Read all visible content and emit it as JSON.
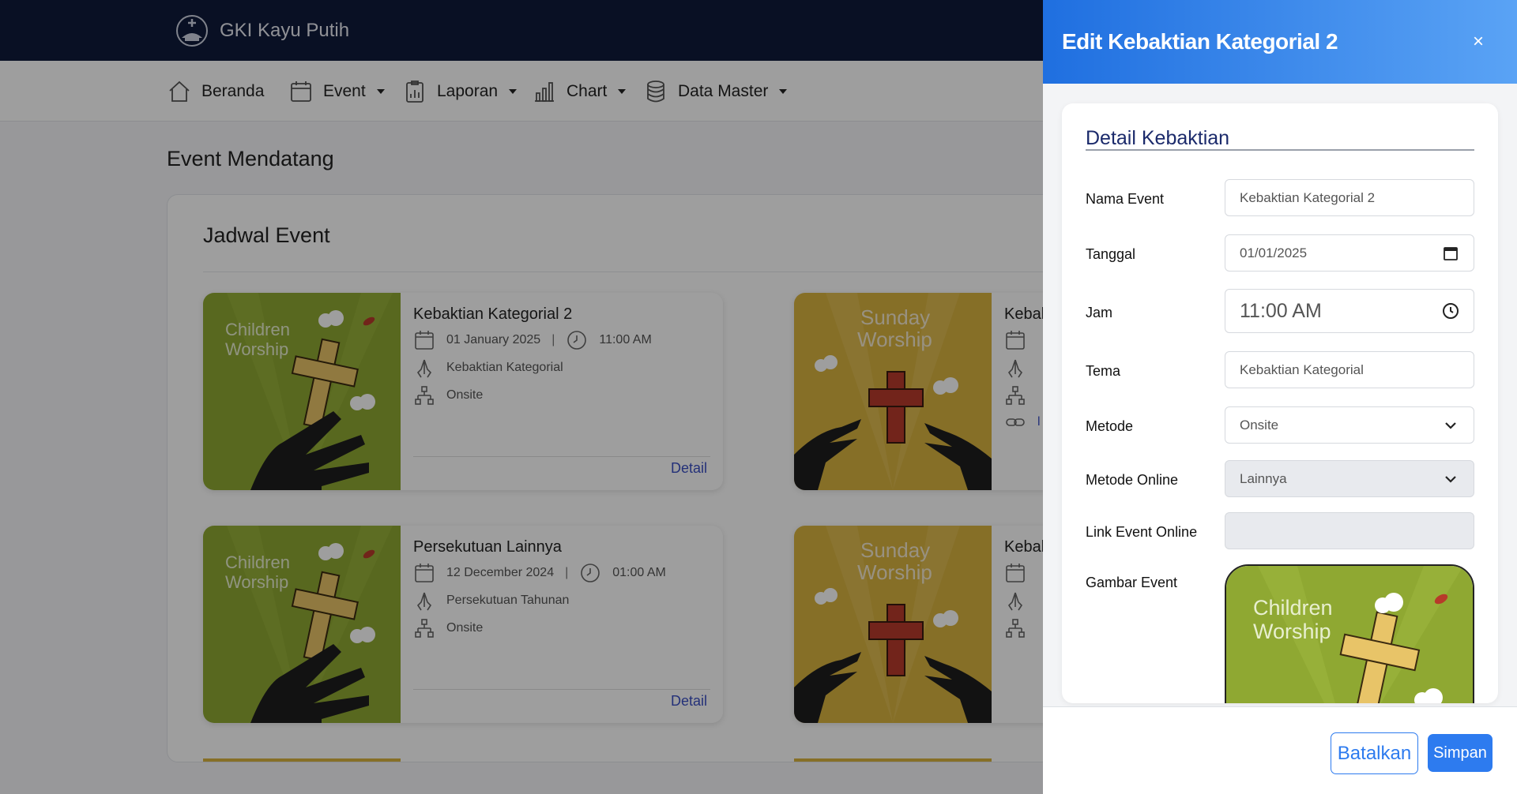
{
  "app": {
    "title": "GKI Kayu Putih"
  },
  "nav": {
    "items": [
      {
        "label": "Beranda",
        "icon": "home-icon"
      },
      {
        "label": "Event",
        "icon": "calendar-icon"
      },
      {
        "label": "Laporan",
        "icon": "report-icon"
      },
      {
        "label": "Chart",
        "icon": "chart-icon"
      },
      {
        "label": "Data Master",
        "icon": "database-icon"
      }
    ]
  },
  "page": {
    "section_title": "Event Mendatang",
    "card_title": "Jadwal Event",
    "detail_label": "Detail"
  },
  "events": [
    {
      "name": "Kebaktian Kategorial 2",
      "date": "01 January 2025",
      "time": "11:00 AM",
      "category": "Kebaktian Kategorial",
      "method": "Onsite",
      "image_text_1": "Children",
      "image_text_2": "Worship"
    },
    {
      "name": "Kebak",
      "image_text_1": "Sunday",
      "image_text_2": "Worship",
      "link_text": "l"
    },
    {
      "name": "Persekutuan Lainnya",
      "date": "12 December 2024",
      "time": "01:00 AM",
      "category": "Persekutuan Tahunan",
      "method": "Onsite",
      "image_text_1": "Children",
      "image_text_2": "Worship"
    },
    {
      "name": "Kebak",
      "image_text_1": "Sunday",
      "image_text_2": "Worship"
    }
  ],
  "panel": {
    "title": "Edit Kebaktian Kategorial 2",
    "close_symbol": "×",
    "section": "Detail Kebaktian",
    "fields": {
      "nama_event": {
        "label": "Nama Event",
        "value": "Kebaktian Kategorial 2"
      },
      "tanggal": {
        "label": "Tanggal",
        "value": "01/01/2025"
      },
      "jam": {
        "label": "Jam",
        "value": "11:00 AM"
      },
      "tema": {
        "label": "Tema",
        "value": "Kebaktian Kategorial"
      },
      "metode": {
        "label": "Metode",
        "value": "Onsite"
      },
      "metode_online": {
        "label": "Metode Online",
        "value": "Lainnya"
      },
      "link_event_online": {
        "label": "Link Event Online",
        "value": ""
      },
      "gambar_event": {
        "label": "Gambar Event",
        "image_text_1": "Children",
        "image_text_2": "Worship"
      }
    },
    "cancel_label": "Batalkan",
    "save_label": "Simpan"
  },
  "colors": {
    "topbar": "#0f1a3a",
    "accent": "#2d7bef",
    "children_bg": "#8fa832",
    "sunday_bg": "#d9b340"
  }
}
